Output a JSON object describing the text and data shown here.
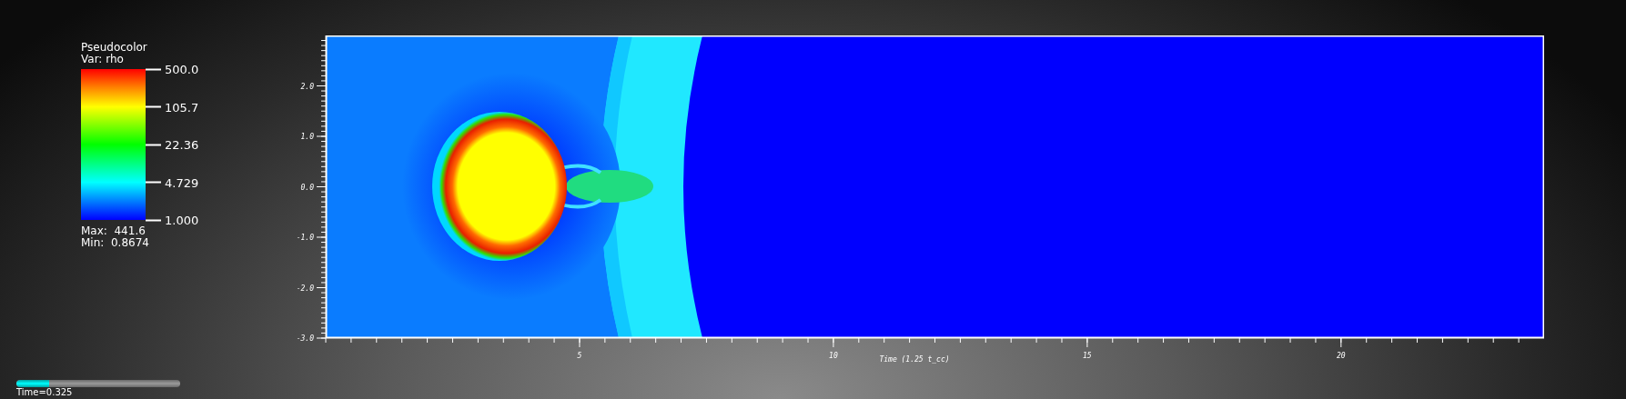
{
  "legend": {
    "title": "Pseudocolor",
    "variable": "Var: rho",
    "ticks": [
      "500.0",
      "105.7",
      "22.36",
      "4.729",
      "1.000"
    ],
    "max": "Max:  441.6",
    "min": "Min:  0.8674"
  },
  "plot": {
    "yticks": [
      "2.0",
      "1.0",
      "0.0",
      "-1.0",
      "-2.0",
      "-3.0"
    ],
    "xticks": [
      "5",
      "10",
      "15",
      "20"
    ],
    "xlabel": "Time (1.25 t_cc)"
  },
  "time_slider": {
    "level": 0.2,
    "label": "Time=0.325"
  }
}
